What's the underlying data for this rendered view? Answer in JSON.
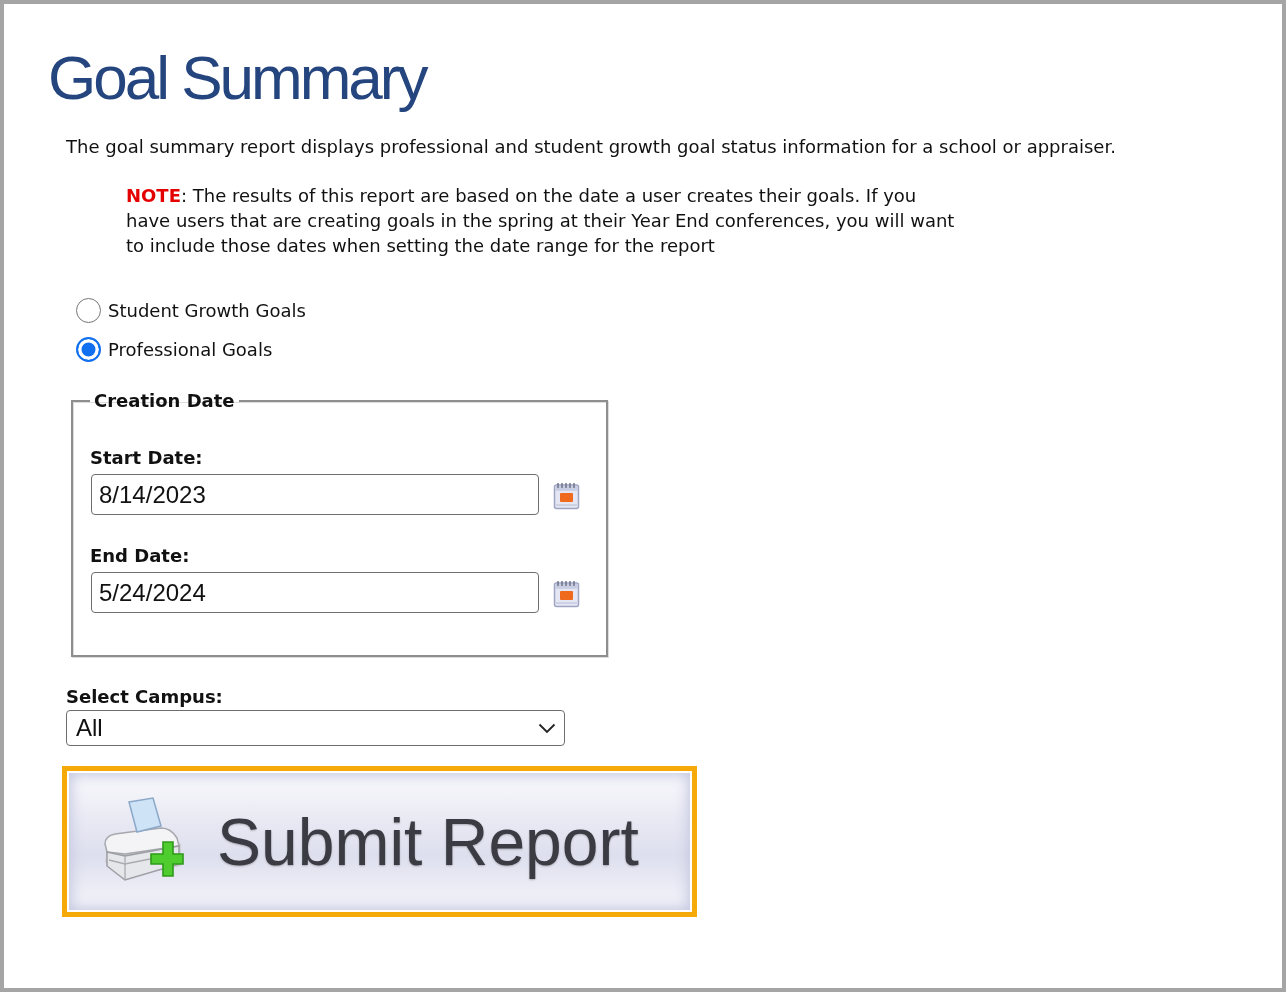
{
  "title": "Goal Summary",
  "description": "The goal summary report displays professional and student growth goal status information for a school or appraiser.",
  "note": "**NOTE**: The results of this report are based on the date a user creates their goals. If you have users that are creating goals in the spring at their Year End conferences, you will want to include those dates when setting the date range for the report",
  "goal_types": [
    {
      "label": "Student Growth Goals",
      "selected": false
    },
    {
      "label": "Professional Goals",
      "selected": true
    }
  ],
  "creation_date": {
    "legend": "Creation Date",
    "fields": [
      {
        "label": "Start Date:",
        "value": "8/14/2023"
      },
      {
        "label": "End Date:",
        "value": "5/24/2024"
      }
    ]
  },
  "campus": {
    "label": "Select Campus:",
    "value": "All"
  },
  "submit_button": {
    "label": "Submit Report"
  }
}
